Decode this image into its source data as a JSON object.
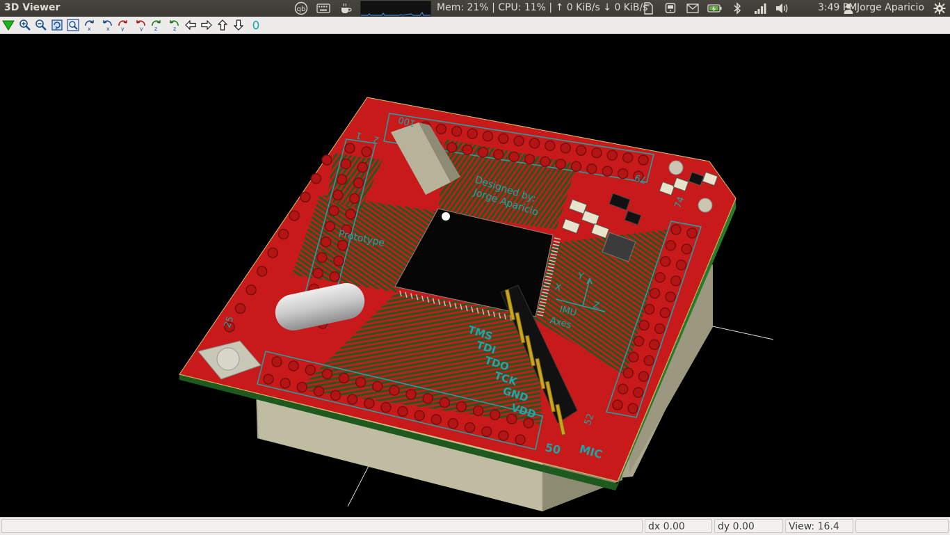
{
  "window": {
    "title": "3D Viewer"
  },
  "panel": {
    "indicators": [
      "qb-icon",
      "keyboard-icon",
      "caffeine-icon",
      "cpu-graph"
    ],
    "sysmon": "Mem: 21% | CPU: 11% | ↑ 0 KiB/s ↓ 0 KiB/s",
    "clock": "3:49 PM",
    "user": "Jorge Aparicio"
  },
  "toolbar": {
    "buttons": [
      "reload-icon",
      "zoom-in-icon",
      "zoom-out-icon",
      "redraw-icon",
      "zoom-fit-icon",
      "rotate-x-cw-icon",
      "rotate-x-ccw-icon",
      "rotate-y-cw-icon",
      "rotate-y-ccw-icon",
      "rotate-z-cw-icon",
      "rotate-z-ccw-icon",
      "move-left-icon",
      "move-right-icon",
      "move-up-icon",
      "move-down-icon",
      "ortho-icon"
    ]
  },
  "board": {
    "labels": {
      "designed": "Designed by:",
      "author": "Jorge Aparicio",
      "prototype": "Prototype",
      "imu": "IMU",
      "axes": "Axes",
      "axis_x": "X",
      "axis_y": "Y",
      "axis_z": "Z",
      "mic": "MIC",
      "jtag": [
        "TMS",
        "TDI",
        "TDO",
        "TCK",
        "GND",
        "VDD"
      ],
      "pin_1": "1",
      "pin_2": "2",
      "pin_100": "100",
      "pin_79": "79",
      "pin_74": "74",
      "pin_50": "50",
      "pin_52": "52",
      "pin_25": "25"
    }
  },
  "status": {
    "dx": "dx 0.00",
    "dy": "dy 0.00",
    "view": "View: 16.4"
  },
  "colors": {
    "pcb_red": "#c81a1a",
    "silkscreen": "#1aa7a7",
    "copper_trace": "#1e5a1e",
    "chip": "#050505"
  }
}
